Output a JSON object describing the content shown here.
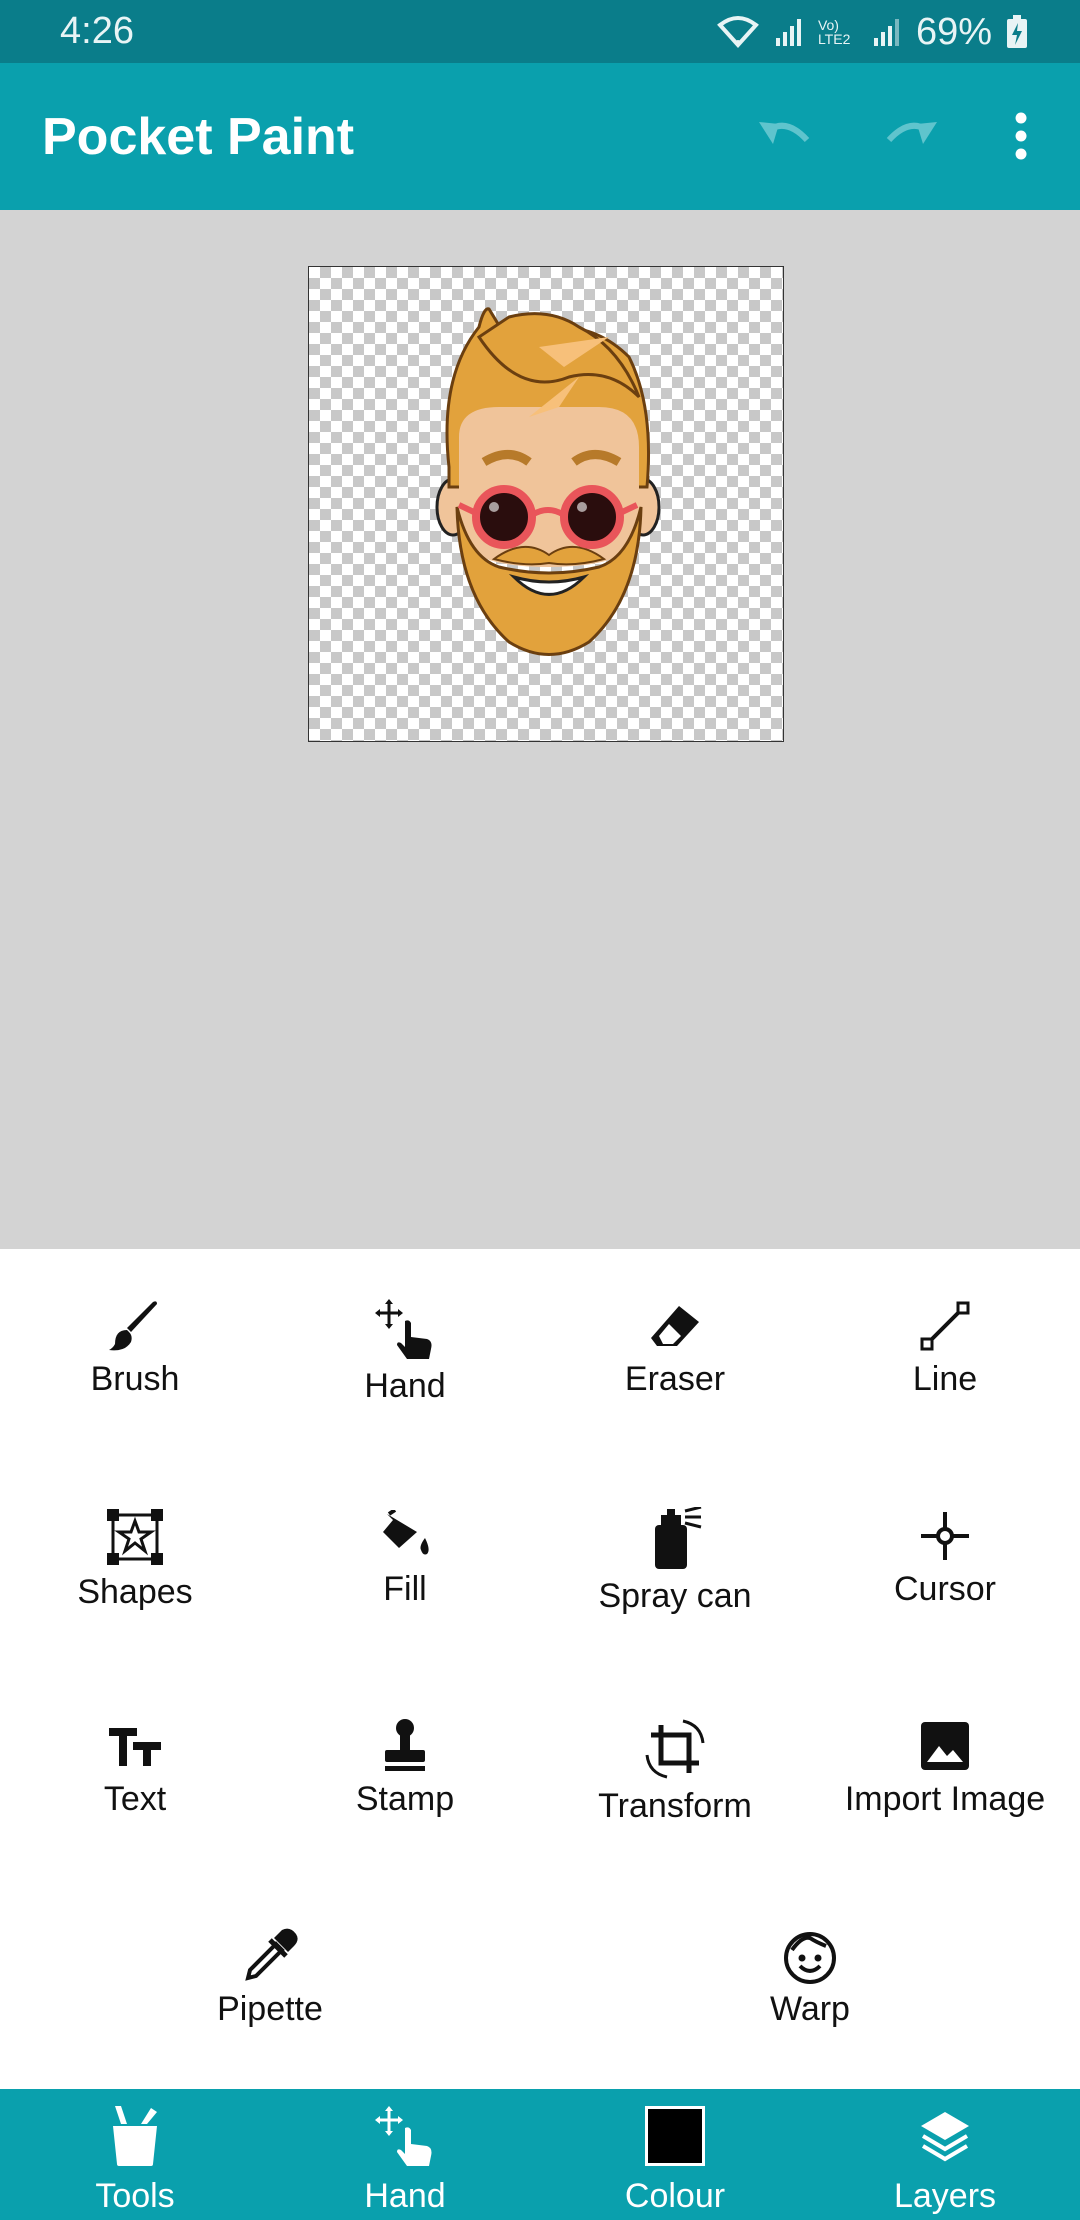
{
  "status": {
    "time": "4:26",
    "battery": "69%",
    "network_label": "Vo) LTE2"
  },
  "appbar": {
    "title": "Pocket Paint",
    "undo_icon": "undo-icon",
    "redo_icon": "redo-icon",
    "menu_icon": "more-vert-icon"
  },
  "canvas": {
    "image": "bearded-man-sticker"
  },
  "tools": [
    {
      "label": "Brush",
      "icon": "brush-icon"
    },
    {
      "label": "Hand",
      "icon": "hand-icon"
    },
    {
      "label": "Eraser",
      "icon": "eraser-icon"
    },
    {
      "label": "Line",
      "icon": "line-icon"
    },
    {
      "label": "Shapes",
      "icon": "shapes-icon"
    },
    {
      "label": "Fill",
      "icon": "fill-icon"
    },
    {
      "label": "Spray can",
      "icon": "spray-can-icon"
    },
    {
      "label": "Cursor",
      "icon": "cursor-icon"
    },
    {
      "label": "Text",
      "icon": "text-icon"
    },
    {
      "label": "Stamp",
      "icon": "stamp-icon"
    },
    {
      "label": "Transform",
      "icon": "transform-icon"
    },
    {
      "label": "Import Image",
      "icon": "import-image-icon"
    },
    {
      "label": "Pipette",
      "icon": "pipette-icon"
    },
    {
      "label": "Warp",
      "icon": "warp-icon"
    }
  ],
  "bottom_nav": [
    {
      "label": "Tools",
      "icon": "tools-icon"
    },
    {
      "label": "Hand",
      "icon": "hand-icon"
    },
    {
      "label": "Colour",
      "icon": "colour-swatch",
      "color": "#000000"
    },
    {
      "label": "Layers",
      "icon": "layers-icon"
    }
  ],
  "colors": {
    "status_bar": "#0a7d8a",
    "app_bar": "#0aa0ad",
    "canvas_bg": "#d3d3d3",
    "accent": "#0aa0ad"
  }
}
